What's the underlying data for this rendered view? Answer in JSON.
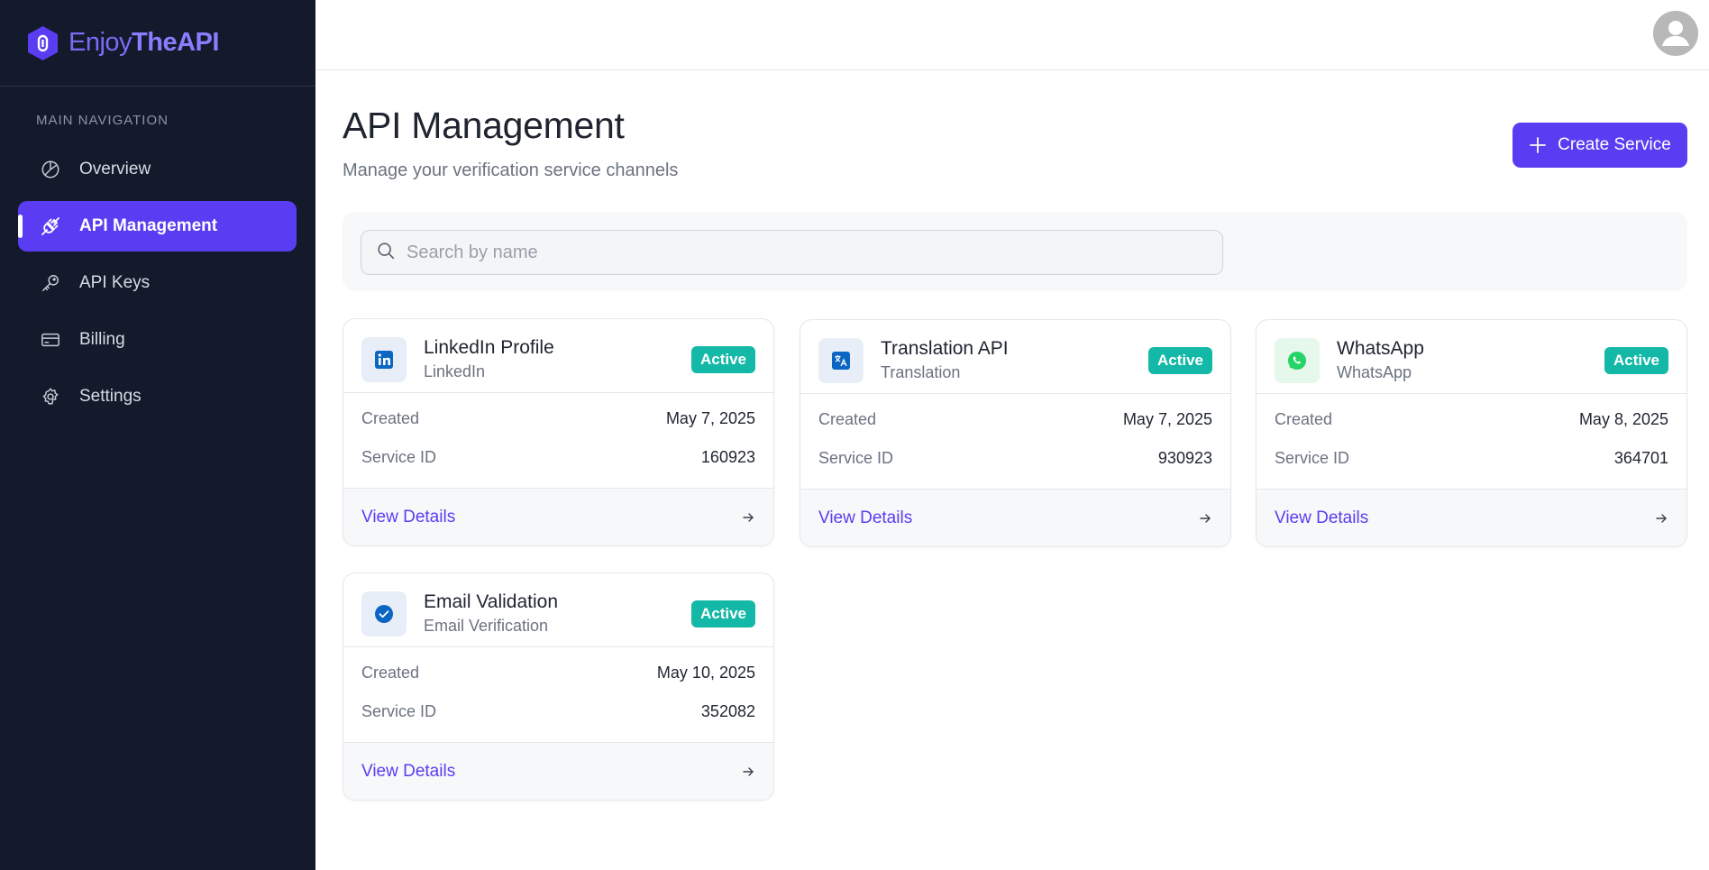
{
  "brand": {
    "name_part1": "Enjoy",
    "name_part2": "TheAPI",
    "accent": "#5a3df2"
  },
  "sidebar": {
    "heading": "MAIN NAVIGATION",
    "items": [
      {
        "label": "Overview",
        "icon": "pie-chart-icon",
        "active": false
      },
      {
        "label": "API Management",
        "icon": "plug-icon",
        "active": true
      },
      {
        "label": "API Keys",
        "icon": "key-icon",
        "active": false
      },
      {
        "label": "Billing",
        "icon": "credit-card-icon",
        "active": false
      },
      {
        "label": "Settings",
        "icon": "gear-icon",
        "active": false
      }
    ]
  },
  "topbar": {
    "avatar_icon": "user-avatar-icon"
  },
  "page": {
    "title": "API Management",
    "subtitle": "Manage your verification service channels",
    "create_button": "Create Service"
  },
  "search": {
    "placeholder": "Search by name",
    "value": ""
  },
  "cards": [
    {
      "name": "LinkedIn Profile",
      "type": "LinkedIn",
      "status": "Active",
      "created_label": "Created",
      "created": "May 7, 2025",
      "id_label": "Service ID",
      "service_id": "160923",
      "link": "View Details",
      "icon": "linkedin-icon"
    },
    {
      "name": "Translation API",
      "type": "Translation",
      "status": "Active",
      "created_label": "Created",
      "created": "May 7, 2025",
      "id_label": "Service ID",
      "service_id": "930923",
      "link": "View Details",
      "icon": "translate-icon"
    },
    {
      "name": "WhatsApp",
      "type": "WhatsApp",
      "status": "Active",
      "created_label": "Created",
      "created": "May 8, 2025",
      "id_label": "Service ID",
      "service_id": "364701",
      "link": "View Details",
      "icon": "whatsapp-icon"
    },
    {
      "name": "Email Validation",
      "type": "Email Verification",
      "status": "Active",
      "created_label": "Created",
      "created": "May 10, 2025",
      "id_label": "Service ID",
      "service_id": "352082",
      "link": "View Details",
      "icon": "check-badge-icon"
    }
  ]
}
